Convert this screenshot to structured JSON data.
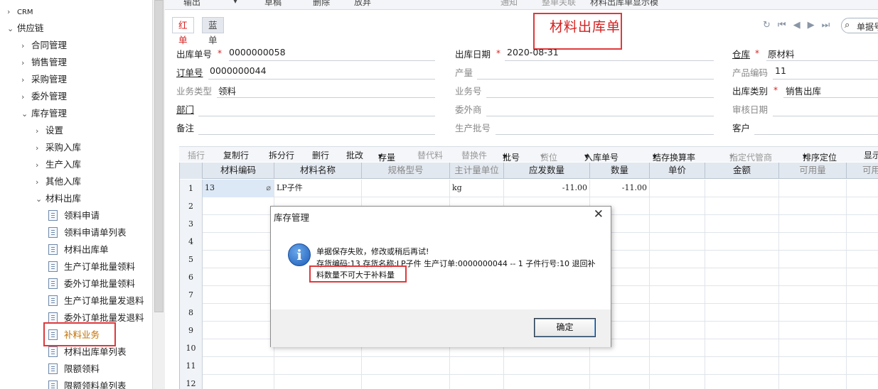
{
  "sidebar": {
    "items": [
      {
        "label": "CRM"
      },
      {
        "label": "供应链"
      },
      {
        "label": "合同管理"
      },
      {
        "label": "销售管理"
      },
      {
        "label": "采购管理"
      },
      {
        "label": "委外管理"
      },
      {
        "label": "库存管理"
      },
      {
        "label": "设置"
      },
      {
        "label": "采购入库"
      },
      {
        "label": "生产入库"
      },
      {
        "label": "其他入库"
      },
      {
        "label": "材料出库"
      },
      {
        "label": "领料申请"
      },
      {
        "label": "领料申请单列表"
      },
      {
        "label": "材料出库单"
      },
      {
        "label": "生产订单批量领料"
      },
      {
        "label": "委外订单批量领料"
      },
      {
        "label": "生产订单批量发退料"
      },
      {
        "label": "委外订单批量发退料"
      },
      {
        "label": "补料业务"
      },
      {
        "label": "材料出库单列表"
      },
      {
        "label": "限额领料"
      },
      {
        "label": "限额领料单列表"
      }
    ]
  },
  "toolbar": {
    "items": [
      "输出",
      "草稿",
      "删除",
      "放弃",
      "通知",
      "整单关联",
      "材料出库单显示模"
    ]
  },
  "tabs": {
    "red": "红单",
    "blue": "蓝单"
  },
  "document_title": "材料出库单",
  "search": {
    "placeholder": "单据号"
  },
  "header": {
    "out_no_label": "出库单号",
    "out_no": "0000000058",
    "order_no_label": "订单号",
    "order_no": "0000000044",
    "biz_type_label": "业务类型",
    "biz_type": "领料",
    "dept_label": "部门",
    "remark_label": "备注",
    "out_date_label": "出库日期",
    "out_date": "2020-08-31",
    "output_label": "产量",
    "biz_no_label": "业务号",
    "outsource_label": "委外商",
    "batch_label": "生产批号",
    "warehouse_label": "仓库",
    "warehouse": "原材料",
    "product_code_label": "产品编码",
    "product_code": "11",
    "out_category_label": "出库类别",
    "out_category": "销售出库",
    "audit_date_label": "审核日期",
    "customer_label": "客户"
  },
  "grid_toolbar": {
    "items": [
      "插行",
      "复制行",
      "拆分行",
      "删行",
      "批改",
      "存量",
      "替代料",
      "替换件",
      "批号",
      "货位",
      "入库单号",
      "结存换算率",
      "指定代管商",
      "排序定位",
      "显示"
    ]
  },
  "grid": {
    "columns": [
      "材料编码",
      "材料名称",
      "规格型号",
      "主计量单位",
      "应发数量",
      "数量",
      "单价",
      "金额",
      "可用量",
      "可用"
    ],
    "rows": [
      {
        "no": "1",
        "code": "13",
        "name": "LP子件",
        "spec": "",
        "unit": "kg",
        "qty_due": "-11.00",
        "qty": "-11.00"
      },
      {
        "no": "2"
      },
      {
        "no": "3"
      },
      {
        "no": "4"
      },
      {
        "no": "5"
      },
      {
        "no": "6"
      },
      {
        "no": "7"
      },
      {
        "no": "8"
      },
      {
        "no": "9"
      },
      {
        "no": "10"
      },
      {
        "no": "11"
      },
      {
        "no": "12"
      }
    ]
  },
  "dialog": {
    "title": "库存管理",
    "line1": "单据保存失败，修改或稍后再试!",
    "line2": "存货编码:13 存货名称:LP子件 生产订单:0000000044 -- 1 子件行号:10 退回补",
    "line3": "料数量不可大于补料量",
    "ok_button": "确定"
  },
  "colors": {
    "accent_red": "#d42020",
    "highlight_box": "#e0383b",
    "active_item": "#c07000"
  }
}
